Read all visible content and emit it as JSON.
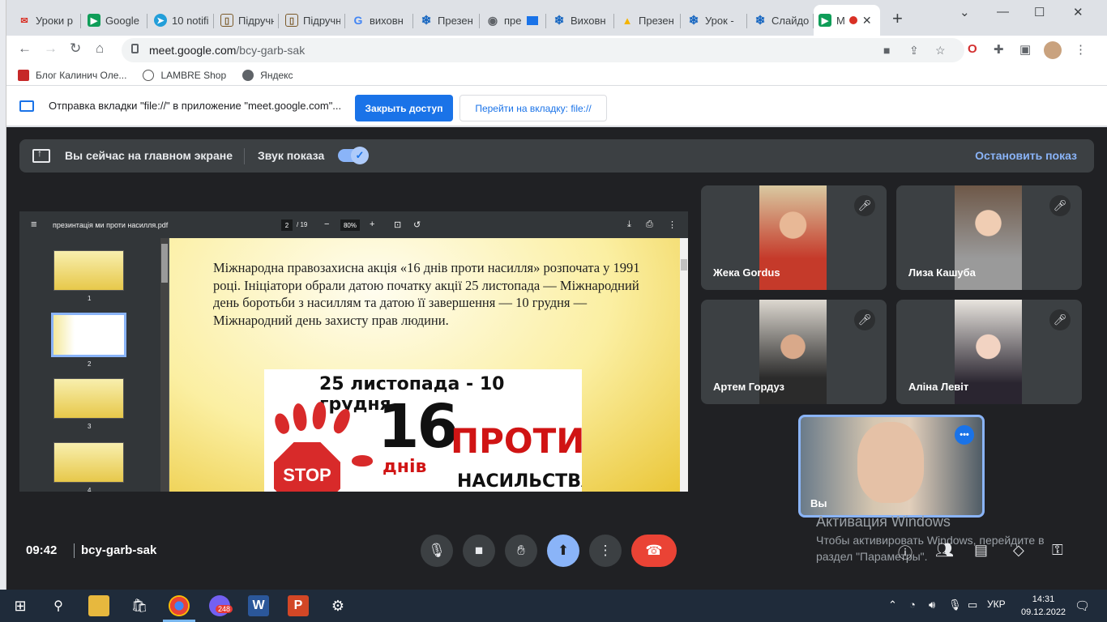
{
  "browser": {
    "tabs": [
      {
        "title": "Уроки р",
        "icon": "email-icon",
        "color": "#d93025"
      },
      {
        "title": "Google",
        "icon": "google-meet-icon",
        "color": "#0f9d58"
      },
      {
        "title": "10 notifi",
        "icon": "telegram-icon",
        "color": "#229ed9"
      },
      {
        "title": "Підручн",
        "icon": "book-icon",
        "color": "#7b5a2a"
      },
      {
        "title": "Підручн",
        "icon": "book-icon",
        "color": "#7b5a2a"
      },
      {
        "title": "виховн",
        "icon": "google-icon",
        "color": "#4285f4"
      },
      {
        "title": "Презен",
        "icon": "snowflake-icon",
        "color": "#1565c0"
      },
      {
        "title": "пре",
        "icon": "globe-icon",
        "color": "#5f6368"
      },
      {
        "title": "Виховн",
        "icon": "snowflake-icon",
        "color": "#1565c0"
      },
      {
        "title": "Презен",
        "icon": "slides-icon",
        "color": "#f4b400"
      },
      {
        "title": "Урок - ",
        "icon": "snowflake-icon",
        "color": "#1565c0"
      },
      {
        "title": "Слайдо",
        "icon": "snowflake-icon",
        "color": "#1565c0"
      },
      {
        "title": "M",
        "icon": "google-meet-icon",
        "color": "#0f9d58"
      }
    ],
    "url_host": "meet.google.com",
    "url_path": "/bcy-garb-sak",
    "bookmarks": [
      {
        "label": "Блог Калинич Оле...",
        "icon": "blog-icon",
        "color": "#c62828"
      },
      {
        "label": "LAMBRE Shop",
        "icon": "lambre-icon",
        "color": "#555555"
      },
      {
        "label": "Яндекс",
        "icon": "globe-icon",
        "color": "#5f6368"
      }
    ]
  },
  "infobar": {
    "message": "Отправка вкладки \"file://\" в приложение \"meet.google.com\"...",
    "stop_button": "Закрыть доступ",
    "switch_button": "Перейти на вкладку: file://"
  },
  "presentation": {
    "status": "Вы сейчас на главном экране",
    "sound_label": "Звук показа",
    "stop_label": "Остановить показ"
  },
  "pdf": {
    "filename": "презинтація ми проти насилля.pdf",
    "page_current": "2",
    "page_total": "/ 19",
    "zoom": "80%",
    "thumb_numbers": [
      "1",
      "2",
      "3",
      "4"
    ],
    "paragraph": "Міжнародна правозахисна акція «16 днів проти насилля» розпочата у 1991 році. Ініціатори обрали датою початку акції  25 листопада — Міжнародний день боротьби з насиллям та датою її завершення — 10 грудня — Міжнародний день захисту прав людини.",
    "poster_dates": "25 листопада - 10 грудня",
    "poster_number": "16",
    "poster_days": "днів",
    "poster_against": "ПРОТИ",
    "poster_violence": "НАСИЛЬСТВА",
    "poster_stop": "STOP"
  },
  "participants": [
    {
      "name": "Жека Gordus"
    },
    {
      "name": "Лиза Кашуба"
    },
    {
      "name": "Артем Гордуз"
    },
    {
      "name": "Аліна Левіт"
    }
  ],
  "self_tile": {
    "name": "Вы"
  },
  "meeting": {
    "time": "09:42",
    "code": "bcy-garb-sak"
  },
  "watermark": {
    "title": "Активация Windows",
    "text": "Чтобы активировать Windows, перейдите в раздел \"Параметры\"."
  },
  "taskbar": {
    "language": "УКР",
    "time": "14:31",
    "date": "09.12.2022",
    "viber_badge": "248"
  }
}
